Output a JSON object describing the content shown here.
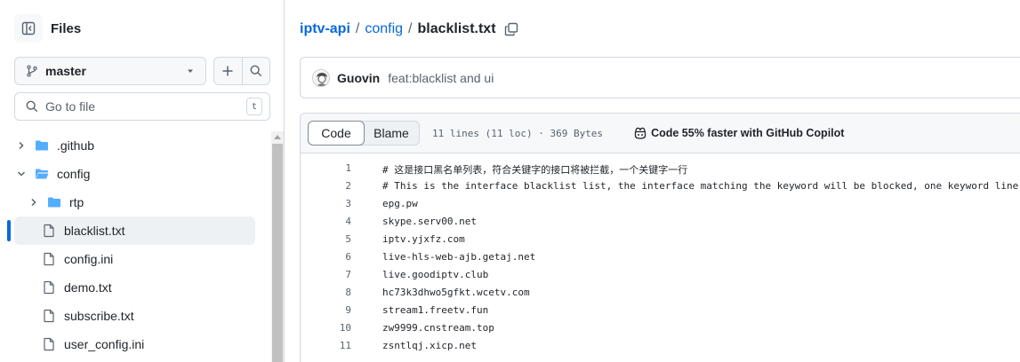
{
  "sidebar": {
    "title": "Files",
    "branch": "master",
    "search": {
      "placeholder": "Go to file",
      "shortcut": "t"
    },
    "tree": [
      {
        "label": ".github",
        "type": "folder",
        "depth": 0,
        "expanded": false
      },
      {
        "label": "config",
        "type": "folder",
        "depth": 0,
        "expanded": true
      },
      {
        "label": "rtp",
        "type": "folder",
        "depth": 1,
        "expanded": false
      },
      {
        "label": "blacklist.txt",
        "type": "file",
        "depth": 1,
        "active": true
      },
      {
        "label": "config.ini",
        "type": "file",
        "depth": 1
      },
      {
        "label": "demo.txt",
        "type": "file",
        "depth": 1
      },
      {
        "label": "subscribe.txt",
        "type": "file",
        "depth": 1
      },
      {
        "label": "user_config.ini",
        "type": "file",
        "depth": 1
      }
    ]
  },
  "breadcrumb": {
    "repo": "iptv-api",
    "sep1": "/",
    "folder": "config",
    "sep2": "/",
    "file": "blacklist.txt"
  },
  "commit": {
    "author": "Guovin",
    "message": "feat:blacklist and ui"
  },
  "file": {
    "tabs": [
      "Code",
      "Blame"
    ],
    "active_tab": "Code",
    "meta": "11 lines (11 loc) · 369 Bytes",
    "copilot": "Code 55% faster with GitHub Copilot",
    "lines": [
      {
        "n": "1",
        "text": "# 这是接口黑名单列表，符合关键字的接口将被拦截，一个关键字一行"
      },
      {
        "n": "2",
        "text": "# This is the interface blacklist list, the interface matching the keyword will be blocked, one keyword line"
      },
      {
        "n": "3",
        "text": "epg.pw"
      },
      {
        "n": "4",
        "text": "skype.serv00.net"
      },
      {
        "n": "5",
        "text": "iptv.yjxfz.com"
      },
      {
        "n": "6",
        "text": "live-hls-web-ajb.getaj.net"
      },
      {
        "n": "7",
        "text": "live.goodiptv.club"
      },
      {
        "n": "8",
        "text": "hc73k3dhwo5gfkt.wcetv.com"
      },
      {
        "n": "9",
        "text": "stream1.freetv.fun"
      },
      {
        "n": "10",
        "text": "zw9999.cnstream.top"
      },
      {
        "n": "11",
        "text": "zsntlqj.xicp.net"
      }
    ]
  },
  "colors": {
    "accent": "#0969da",
    "folder": "#54aeff",
    "border": "#d1d9e0",
    "muted": "#59636e"
  }
}
